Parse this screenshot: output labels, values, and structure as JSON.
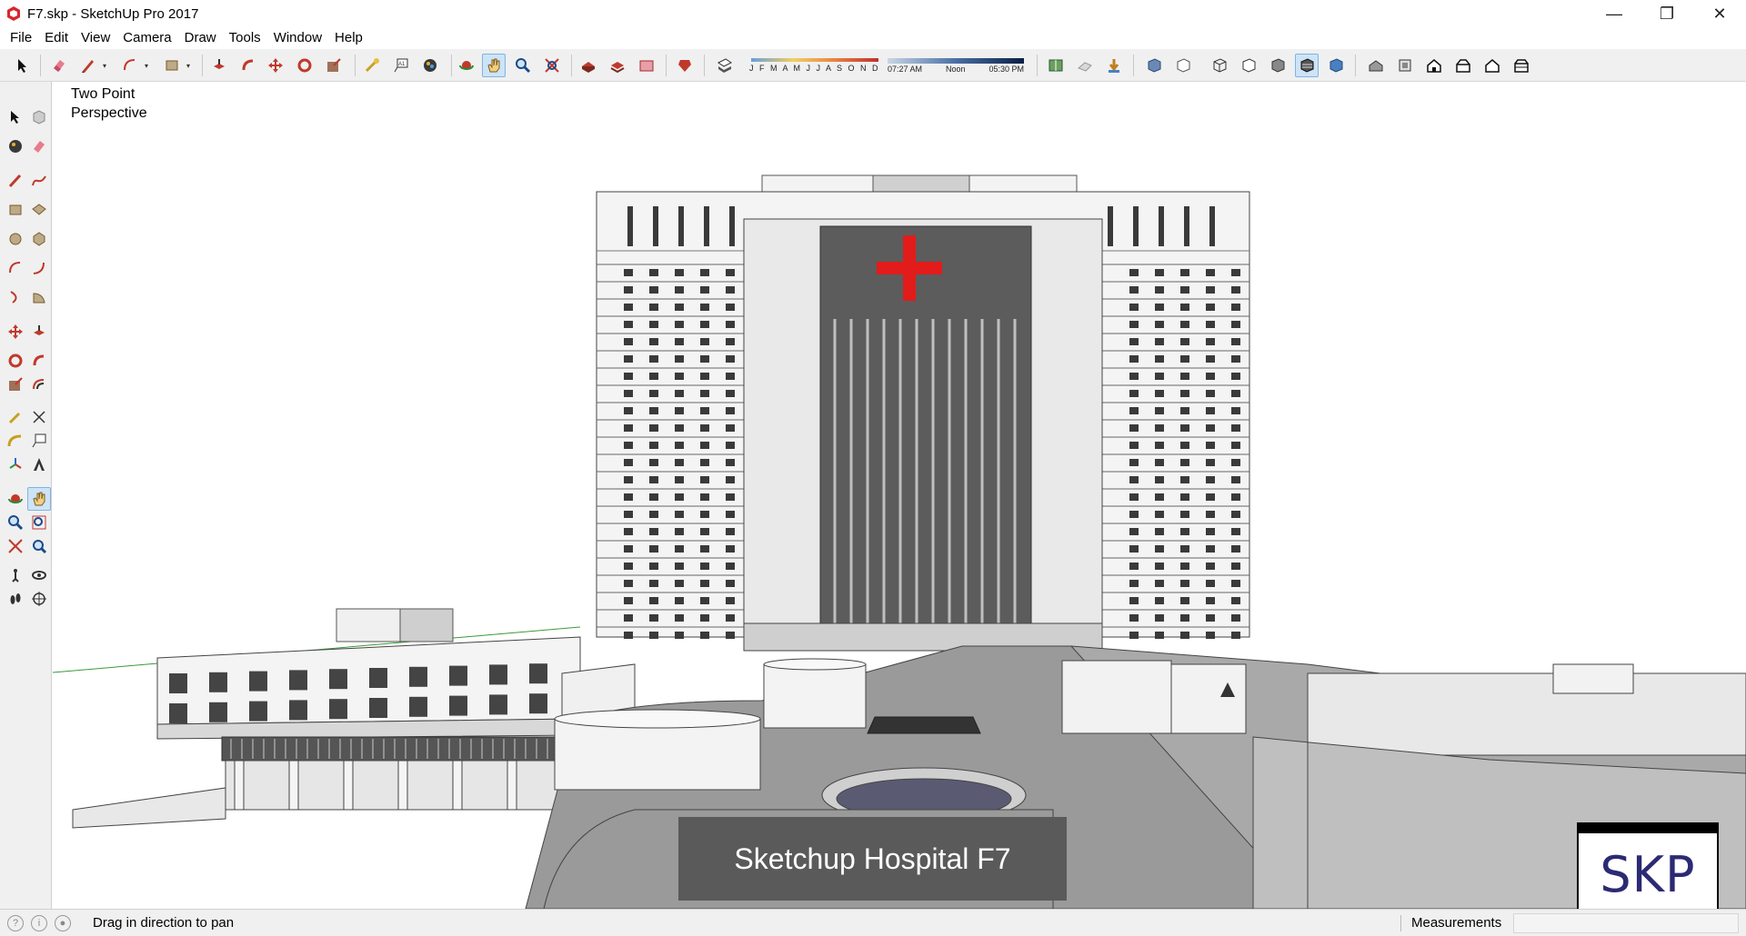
{
  "window": {
    "title": "F7.skp - SketchUp Pro 2017",
    "minimize_glyph": "—",
    "restore_glyph": "❐",
    "close_glyph": "✕"
  },
  "menu": {
    "items": [
      "File",
      "Edit",
      "View",
      "Camera",
      "Draw",
      "Tools",
      "Window",
      "Help"
    ]
  },
  "toolbar": {
    "months": "J F M A M J J A S O N D",
    "time_start": "07:27 AM",
    "time_mid": "Noon",
    "time_end": "05:30 PM"
  },
  "viewport": {
    "scene_label_line1": "Two Point",
    "scene_label_line2": "Perspective",
    "caption": "Sketchup Hospital F7",
    "logo": "SKP"
  },
  "status": {
    "hint": "Drag in direction to pan",
    "measurements_label": "Measurements",
    "measurements_value": ""
  },
  "colors": {
    "accent_cross": "#e21b1b",
    "active_tool": "#cde4f7"
  }
}
